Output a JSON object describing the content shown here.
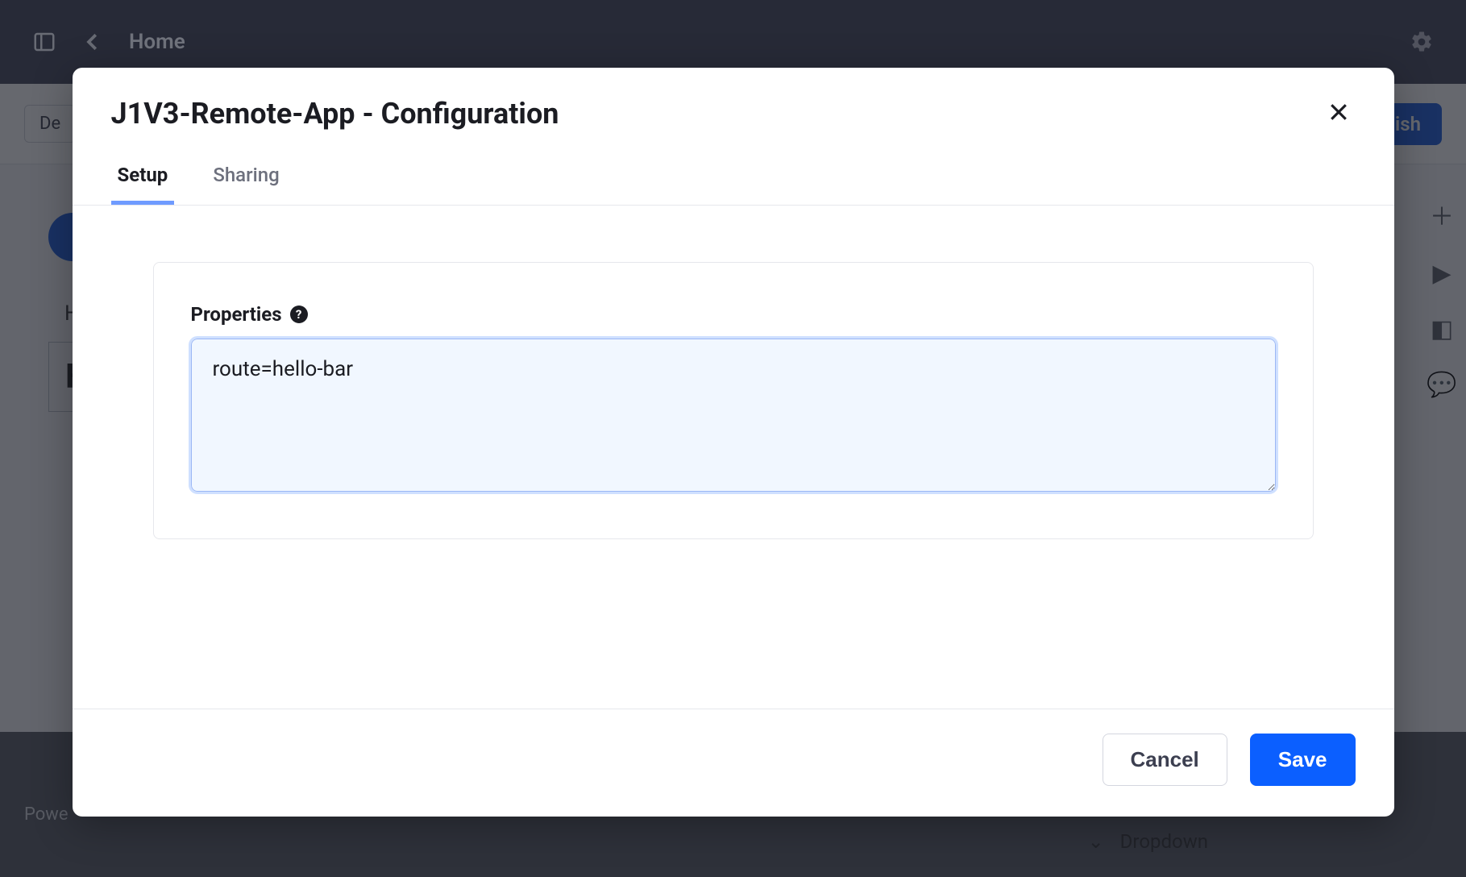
{
  "topbar": {
    "home_label": "Home"
  },
  "backdrop": {
    "default_btn": "De",
    "publish_btn": "lish",
    "h_text": "H",
    "he_text": "He",
    "footer": "Powe",
    "dropdown_label": "Dropdown"
  },
  "modal": {
    "title": "J1V3-Remote-App - Configuration",
    "tabs": {
      "setup": "Setup",
      "sharing": "Sharing"
    },
    "field": {
      "properties_label": "Properties",
      "properties_value": "route=hello-bar"
    },
    "footer": {
      "cancel": "Cancel",
      "save": "Save"
    }
  }
}
